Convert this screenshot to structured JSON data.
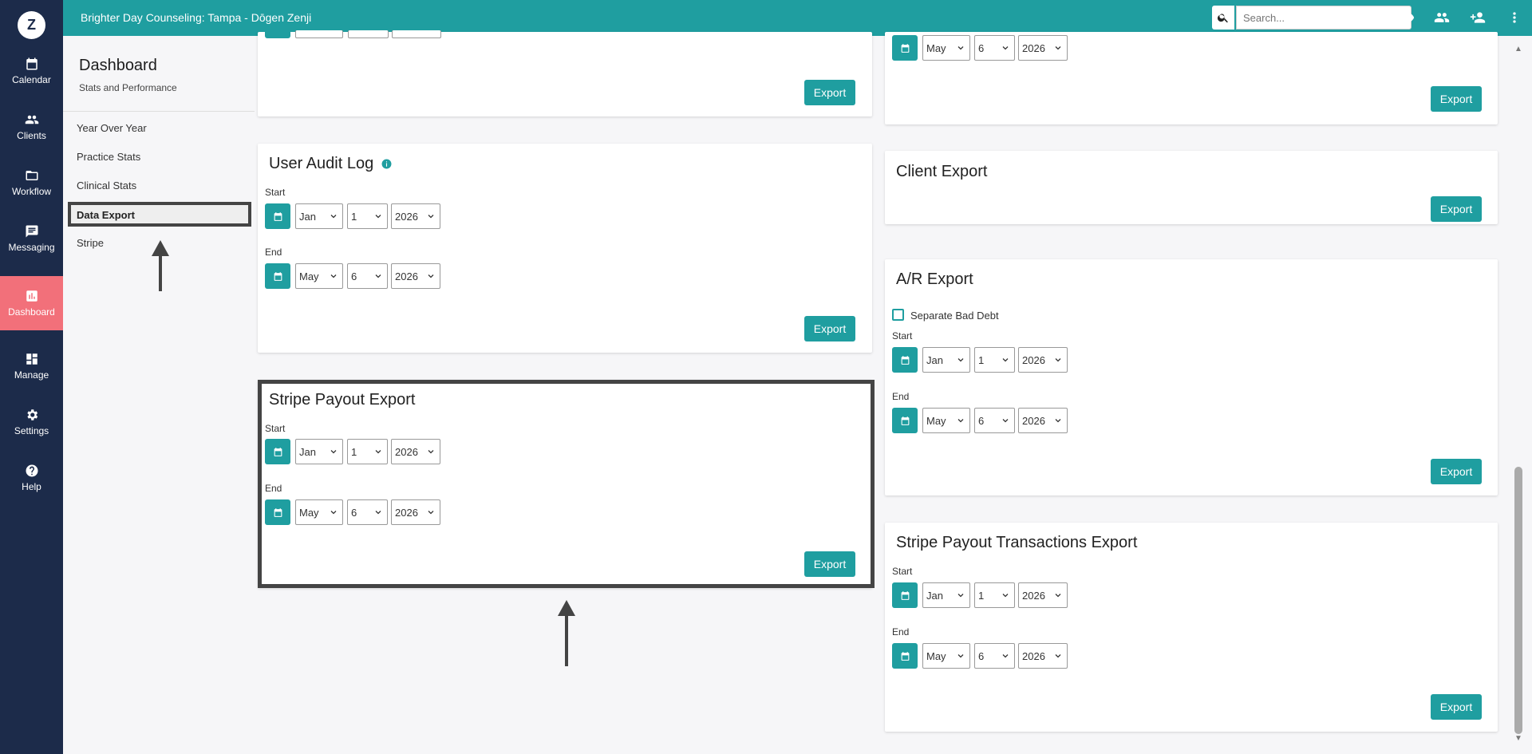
{
  "app": {
    "logo_letter": "Z",
    "practice_title": "Brighter Day Counseling: Tampa - Dōgen Zenji"
  },
  "colors": {
    "teal": "#1f9ea0",
    "navy": "#1c2b4a",
    "active_nav": "#f2707a"
  },
  "left_nav": [
    {
      "label": "Calendar",
      "icon": "calendar-icon"
    },
    {
      "label": "Clients",
      "icon": "people-icon"
    },
    {
      "label": "Workflow",
      "icon": "folder-icon"
    },
    {
      "label": "Messaging",
      "icon": "chat-icon"
    },
    {
      "label": "Dashboard",
      "icon": "chart-icon",
      "active": true
    },
    {
      "label": "Manage",
      "icon": "grid-icon"
    },
    {
      "label": "Settings",
      "icon": "gear-icon"
    },
    {
      "label": "Help",
      "icon": "help-icon"
    }
  ],
  "search": {
    "placeholder": "Search..."
  },
  "sidebar": {
    "title": "Dashboard",
    "subtitle": "Stats and Performance",
    "items": [
      "Year Over Year",
      "Practice Stats",
      "Clinical Stats",
      "Data Export",
      "Stripe"
    ],
    "active_item": "Data Export"
  },
  "export_label": "Export",
  "start_label": "Start",
  "end_label": "End",
  "start_date": {
    "month": "Jan",
    "day": "1",
    "year": "2026"
  },
  "end_date": {
    "month": "May",
    "day": "6",
    "year": "2026"
  },
  "cards": {
    "user_audit_log": {
      "title": "User Audit Log"
    },
    "stripe_payout_export": {
      "title": "Stripe Payout Export"
    },
    "client_export": {
      "title": "Client Export"
    },
    "ar_export": {
      "title": "A/R Export",
      "checkbox_label": "Separate Bad Debt",
      "checkbox_checked": false
    },
    "stripe_payout_transactions_export": {
      "title": "Stripe Payout Transactions Export"
    }
  }
}
